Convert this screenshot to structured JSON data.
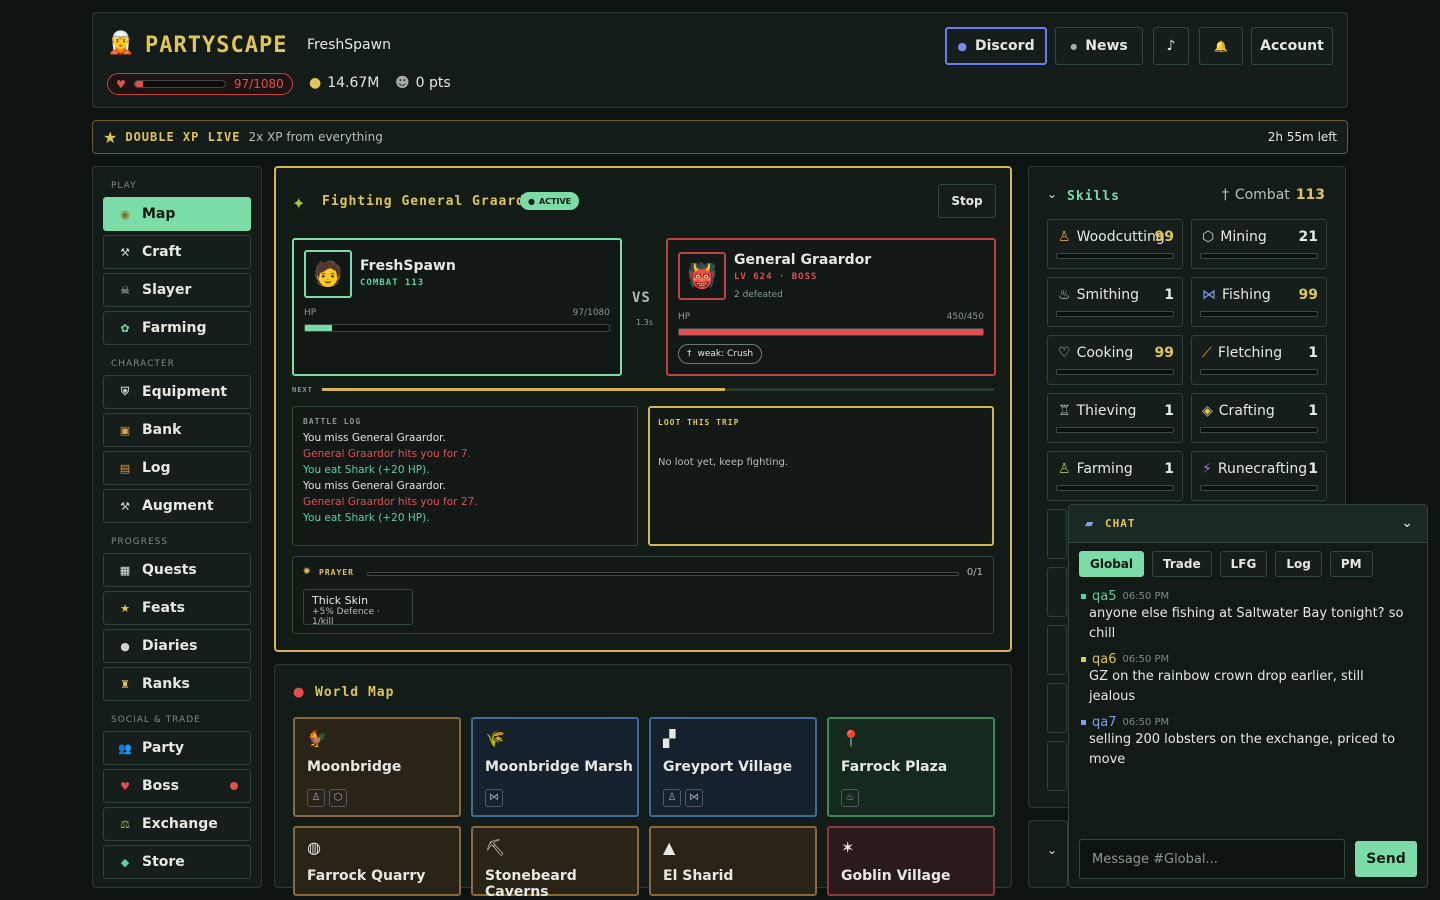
{
  "header": {
    "logo": "PARTYSCAPE",
    "username": "FreshSpawn",
    "hp": "97/1080",
    "hp_fraction": 0.09,
    "gold": "14.67M",
    "points": "0 pts",
    "discord": "Discord",
    "news": "News",
    "music_icon": "♪",
    "bell_icon": "🔔",
    "account": "Account"
  },
  "banner": {
    "title": "DOUBLE XP LIVE",
    "text": "2x XP from everything",
    "time": "2h 55m left"
  },
  "nav": {
    "play": "PLAY",
    "character": "CHARACTER",
    "progress": "PROGRESS",
    "social": "SOCIAL & TRADE",
    "items": [
      {
        "label": "Map",
        "icon": "◉"
      },
      {
        "label": "Craft",
        "icon": "⚒"
      },
      {
        "label": "Slayer",
        "icon": "☠"
      },
      {
        "label": "Farming",
        "icon": "✿"
      },
      {
        "label": "Equipment",
        "icon": "⛨"
      },
      {
        "label": "Bank",
        "icon": "▣"
      },
      {
        "label": "Log",
        "icon": "▤"
      },
      {
        "label": "Augment",
        "icon": "⚒"
      },
      {
        "label": "Quests",
        "icon": "▦"
      },
      {
        "label": "Feats",
        "icon": "★"
      },
      {
        "label": "Diaries",
        "icon": "●"
      },
      {
        "label": "Ranks",
        "icon": "♜"
      },
      {
        "label": "Party",
        "icon": "👥"
      },
      {
        "label": "Boss",
        "icon": "♥"
      },
      {
        "label": "Exchange",
        "icon": "⚖"
      },
      {
        "label": "Store",
        "icon": "◆"
      }
    ]
  },
  "combat": {
    "title": "Fighting General Graardor",
    "status": "ACTIVE",
    "stop": "Stop",
    "player": {
      "name": "FreshSpawn",
      "combat": "COMBAT 113",
      "hp_label": "HP",
      "hp": "97/1080",
      "hp_fraction": 0.09
    },
    "vs": "VS",
    "speed": "1.3s",
    "enemy": {
      "name": "General Graardor",
      "level": "LV 624 · BOSS",
      "defeated": "2 defeated",
      "hp_label": "HP",
      "hp": "450/450",
      "hp_fraction": 1.0,
      "weak": "weak: Crush"
    },
    "next": "NEXT",
    "next_fraction": 0.6,
    "log_title": "BATTLE LOG",
    "log": [
      "You miss General Graardor.",
      "General Graardor hits you for 7.",
      "You eat Shark (+20 HP).",
      "You miss General Graardor.",
      "General Graardor hits you for 27.",
      "You eat Shark (+20 HP)."
    ],
    "loot_title": "LOOT THIS TRIP",
    "loot_text": "No loot yet, keep fighting.",
    "prayer": {
      "label": "PRAYER",
      "count": "0/1",
      "name": "Thick Skin",
      "effect": "+5% Defence · 1/kill"
    }
  },
  "world": {
    "title": "World Map",
    "locations": [
      {
        "name": "Moonbridge",
        "icon": "🐓"
      },
      {
        "name": "Moonbridge Marsh",
        "icon": "🌾"
      },
      {
        "name": "Greyport Village",
        "icon": "▞"
      },
      {
        "name": "Farrock Plaza",
        "icon": "📍"
      },
      {
        "name": "Farrock Quarry",
        "icon": "◍"
      },
      {
        "name": "Stonebeard Caverns",
        "icon": "⛏"
      },
      {
        "name": "El Sharid",
        "icon": "▲"
      },
      {
        "name": "Goblin Village",
        "icon": "✶"
      }
    ]
  },
  "skills": {
    "title": "Skills",
    "combat_label": "Combat",
    "combat": "113",
    "list": [
      {
        "name": "Woodcutting",
        "level": "99",
        "icon": "♙"
      },
      {
        "name": "Mining",
        "level": "21",
        "icon": "⬡"
      },
      {
        "name": "Smithing",
        "level": "1",
        "icon": "♨"
      },
      {
        "name": "Fishing",
        "level": "99",
        "icon": "⋈"
      },
      {
        "name": "Cooking",
        "level": "99",
        "icon": "♡"
      },
      {
        "name": "Fletching",
        "level": "1",
        "icon": "⟋"
      },
      {
        "name": "Thieving",
        "level": "1",
        "icon": "♖"
      },
      {
        "name": "Crafting",
        "level": "1",
        "icon": "◈"
      },
      {
        "name": "Farming",
        "level": "1",
        "icon": "♙"
      },
      {
        "name": "Runecrafting",
        "level": "1",
        "icon": "⚡"
      }
    ]
  },
  "chat": {
    "title": "CHAT",
    "tabs": [
      "Global",
      "Trade",
      "LFG",
      "Log",
      "PM"
    ],
    "messages": [
      {
        "user": "qa5",
        "time": "06:50 PM",
        "text": "anyone else fishing at Saltwater Bay tonight? so chill",
        "color": "#5ad1a0"
      },
      {
        "user": "qa6",
        "time": "06:50 PM",
        "text": "GZ on the rainbow crown drop earlier, still jealous",
        "color": "#e0c45a"
      },
      {
        "user": "qa7",
        "time": "06:50 PM",
        "text": "selling 200 lobsters on the exchange, priced to move",
        "color": "#7aa0e8"
      }
    ],
    "placeholder": "Message #Global...",
    "send": "Send"
  }
}
